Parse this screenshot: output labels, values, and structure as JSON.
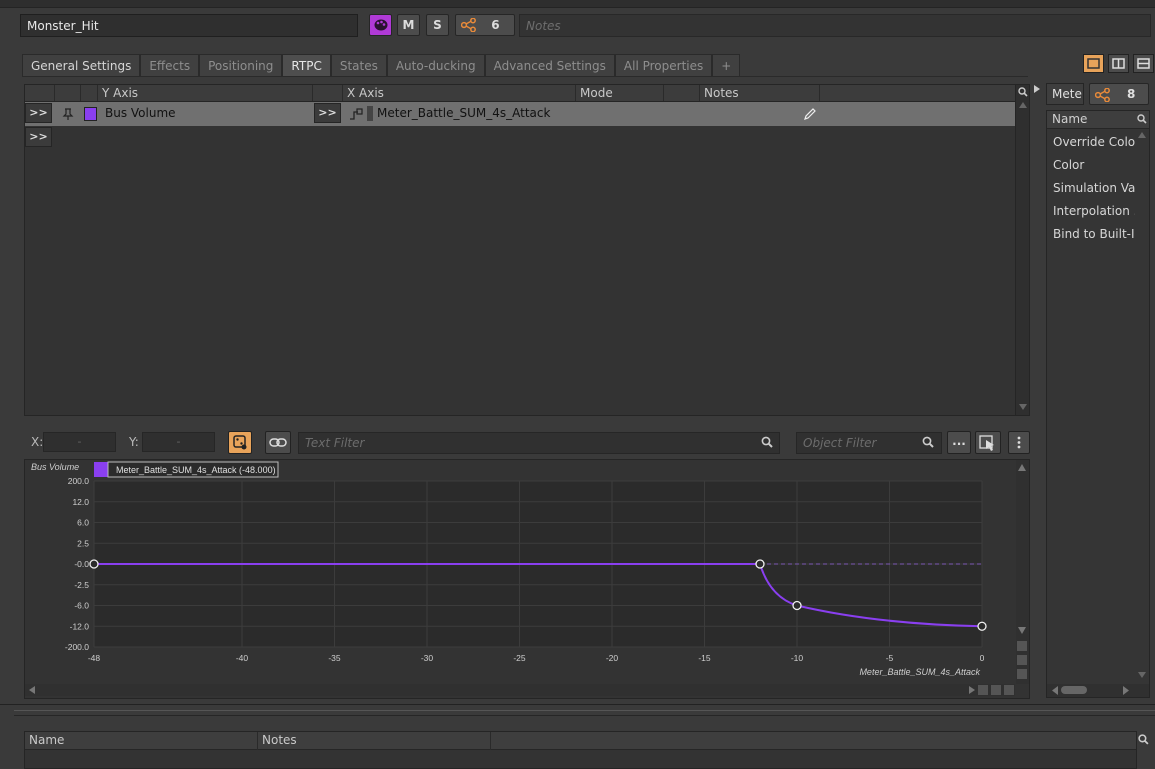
{
  "object": {
    "name": "Monster_Hit",
    "mute_label": "M",
    "solo_label": "S",
    "reference_count": "6",
    "notes_placeholder": "Notes",
    "palette_color": "#b03ad6"
  },
  "tabs": [
    {
      "label": "General Settings",
      "active": false
    },
    {
      "label": "Effects",
      "active": false
    },
    {
      "label": "Positioning",
      "active": false
    },
    {
      "label": "RTPC",
      "active": true
    },
    {
      "label": "States",
      "active": false
    },
    {
      "label": "Auto-ducking",
      "active": false
    },
    {
      "label": "Advanced Settings",
      "active": false
    },
    {
      "label": "All Properties",
      "active": false
    },
    {
      "label": "+",
      "active": false
    }
  ],
  "rtpc_table": {
    "columns": [
      "Y Axis",
      "X Axis",
      "Mode",
      "Notes"
    ],
    "expand_label": ">>",
    "rows": [
      {
        "y_axis": "Bus Volume",
        "x_axis": "Meter_Battle_SUM_4s_Attack",
        "mode": "",
        "notes": "",
        "color": "#8a3ff0"
      }
    ]
  },
  "graph_toolbar": {
    "x_label": "X:",
    "y_label": "Y:",
    "x_value": "-",
    "y_value": "-",
    "text_filter_placeholder": "Text Filter",
    "object_filter_placeholder": "Object Filter",
    "more_label": "..."
  },
  "chart_data": {
    "type": "line",
    "ylabel": "Bus Volume",
    "xlabel": "Meter_Battle_SUM_4s_Attack",
    "legend": "Meter_Battle_SUM_4s_Attack (-48.000)",
    "xlim": [
      -48,
      0
    ],
    "x_ticks": [
      "-48",
      "-40",
      "-35",
      "-30",
      "-25",
      "-20",
      "-15",
      "-10",
      "-5",
      "0"
    ],
    "x_tick_values": [
      -48,
      -40,
      -35,
      -30,
      -25,
      -20,
      -15,
      -10,
      -5,
      0
    ],
    "y_ticks": [
      "200.0",
      "12.0",
      "6.0",
      "2.5",
      "-0.0",
      "-2.5",
      "-6.0",
      "-12.0",
      "-200.0"
    ],
    "points": [
      {
        "x": -48,
        "y": 0
      },
      {
        "x": -12,
        "y": 0
      },
      {
        "x": -10,
        "y": -6
      },
      {
        "x": 0,
        "y": -12
      }
    ],
    "line_color": "#8a3ff0",
    "grid": true
  },
  "right_panel": {
    "title": "Mete",
    "count": "8",
    "column": "Name",
    "items": [
      "Override Color",
      "Color",
      "Simulation Val...",
      "Interpolation ...",
      "Bind to Built-I..."
    ]
  },
  "bottom_table": {
    "columns": [
      "Name",
      "Notes"
    ]
  }
}
